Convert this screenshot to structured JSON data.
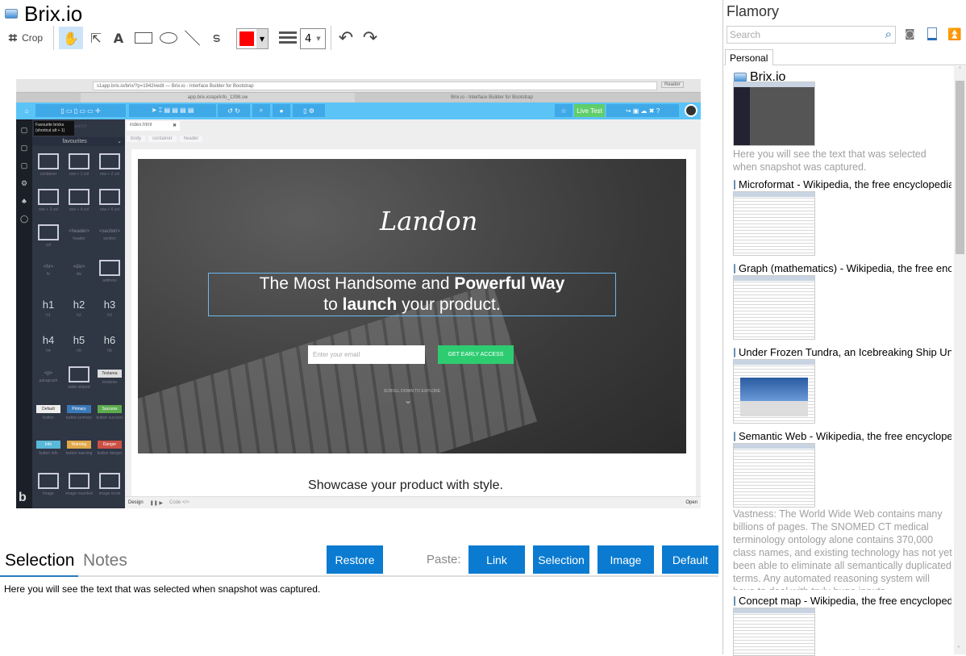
{
  "window": {
    "title": "Brix.io"
  },
  "toolbar": {
    "crop_label": "Crop",
    "line_width": "4",
    "color": "#ff0000",
    "tools": [
      "hand",
      "pointer",
      "text",
      "rectangle",
      "ellipse",
      "line",
      "freehand"
    ]
  },
  "screenshot": {
    "url": "s1app.brix.io/brix/?p=1942#edit — Brix.io - Interface Builder for Bootstrap",
    "tab1": "app.brix.io/api/info_1398.sw",
    "tab2": "Brix.io - Interface Builder for Bootstrap",
    "reader": "Reader",
    "live_test": "Live Test",
    "tooltip": "Favourite bricks (shortcut alt + 1)",
    "search_placeholder": "alt+search",
    "category": "favourites",
    "file_tab": "index.html",
    "breadcrumb": [
      "body",
      "container",
      "header"
    ],
    "bricks": [
      {
        "g": "",
        "l": "container"
      },
      {
        "g": "",
        "l": "row + 1 col"
      },
      {
        "g": "",
        "l": "row + 2 col"
      },
      {
        "g": "",
        "l": "row + 3 col"
      },
      {
        "g": "",
        "l": "row + 4 col"
      },
      {
        "g": "",
        "l": "row + 6 col"
      },
      {
        "g": "",
        "l": "col"
      },
      {
        "g": "<header>",
        "l": "header"
      },
      {
        "g": "<section>",
        "l": "section"
      },
      {
        "g": "<hr>",
        "l": "hr"
      },
      {
        "g": "<div>",
        "l": "div"
      },
      {
        "g": "",
        "l": "address"
      },
      {
        "g": "h1",
        "l": "h1"
      },
      {
        "g": "h2",
        "l": "h2"
      },
      {
        "g": "h3",
        "l": "h3"
      },
      {
        "g": "h4",
        "l": "h4"
      },
      {
        "g": "h5",
        "l": "h5"
      },
      {
        "g": "h6",
        "l": "h6"
      },
      {
        "g": "<p>",
        "l": "paragraph"
      },
      {
        "g": "",
        "l": "table striped"
      },
      {
        "g": "Textarea",
        "l": "textarea"
      },
      {
        "g": "Default",
        "l": "button"
      },
      {
        "g": "Primary",
        "l": "button primary"
      },
      {
        "g": "Success",
        "l": "button success"
      },
      {
        "g": "Info",
        "l": "button info"
      },
      {
        "g": "Warning",
        "l": "button warning"
      },
      {
        "g": "Danger",
        "l": "button danger"
      },
      {
        "g": "",
        "l": "image"
      },
      {
        "g": "",
        "l": "image rounded"
      },
      {
        "g": "",
        "l": "image circle"
      }
    ],
    "logo": "Landon",
    "headline1": "The Most Handsome and ",
    "headline1_bold": "Powerful Way",
    "headline2a": "to ",
    "headline2_bold": "launch",
    "headline2b": " your product.",
    "email_placeholder": "Enter your email",
    "cta": "GET EARLY ACCESS",
    "scroll": "SCROLL DOWN TO EXPLORE",
    "showcase": "Showcase your product with style.",
    "bottom_design": "Design",
    "bottom_code": "Code </>",
    "bottom_open": "Open"
  },
  "bottom": {
    "tabs": [
      "Selection",
      "Notes"
    ],
    "restore": "Restore",
    "paste_label": "Paste:",
    "paste_buttons": [
      "Link",
      "Selection",
      "Image",
      "Default"
    ],
    "selection_text": "Here you will see the text that was selected when snapshot was captured."
  },
  "sidebar": {
    "app_name": "Flamory",
    "search_placeholder": "Search",
    "tab": "Personal",
    "items": [
      {
        "title": "Brix.io",
        "text": "Here you will see the text that was selected when snapshot was captured."
      },
      {
        "title": "Microformat - Wikipedia, the free encyclopedia"
      },
      {
        "title": "Graph (mathematics) - Wikipedia, the free encyclopedia"
      },
      {
        "title": "Under Frozen Tundra, an Icebreaking Ship Uncovers"
      },
      {
        "title": "Semantic Web - Wikipedia, the free encyclopedia",
        "text": "Vastness: The World Wide Web contains many billions of pages. The SNOMED CT medical terminology ontology alone contains 370,000 class names, and existing technology has not yet been able to eliminate all semantically duplicated terms. Any automated reasoning system will have to deal with truly huge inputs."
      },
      {
        "title": "Concept map - Wikipedia, the free encyclopedia"
      }
    ]
  }
}
